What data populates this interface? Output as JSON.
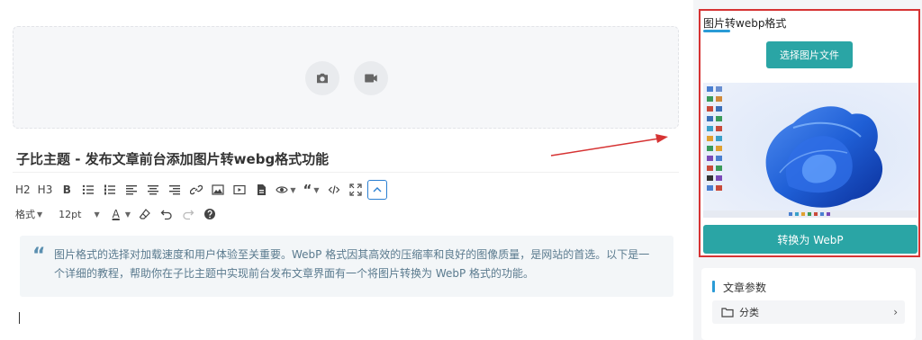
{
  "editor": {
    "media": {
      "photo_icon": "camera-icon",
      "video_icon": "video-icon"
    },
    "title": "子比主题 - 发布文章前台添加图片转webg格式功能",
    "toolbar": {
      "h2": "H2",
      "h3": "H3",
      "bold": "B",
      "format": "格式",
      "font_size": "12pt",
      "font_color": "A"
    },
    "quote": {
      "icon": "“",
      "text": "图片格式的选择对加载速度和用户体验至关重要。WebP 格式因其高效的压缩率和良好的图像质量，是网站的首选。以下是一个详细的教程，帮助你在子比主题中实现前台发布文章界面有一个将图片转换为 WebP 格式的功能。"
    }
  },
  "webp_panel": {
    "title": "图片转webp格式",
    "select_label": "选择图片文件",
    "convert_label": "转换为 WebP",
    "highlight_color": "#d63333",
    "accent_color": "#2aa5a5"
  },
  "article_params": {
    "title": "文章参数",
    "category_label": "分类"
  }
}
